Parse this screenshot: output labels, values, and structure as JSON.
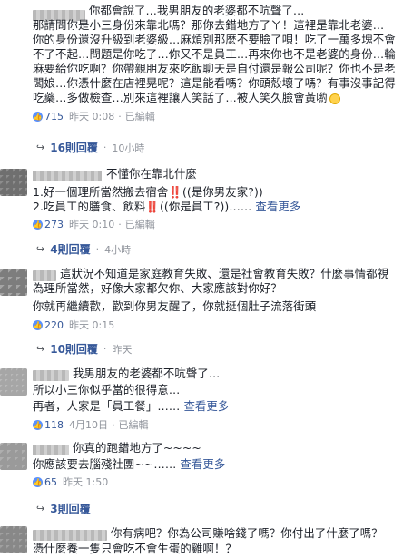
{
  "c1": {
    "lines": [
      "你都會說了…我男朋友的老婆都不吭聲了…",
      "那請問你是小三身份來靠北嗎？那你去錯地方了ㄚ！這裡是靠北老婆…",
      "你的身份還沒升級到老婆級…麻煩別那麼不要臉了唄！吃了一萬多塊不會",
      "不了不起…問題是你吃了…你又不是員工…再來你也不是老婆的身份…輪",
      "麻要給你吃啊？你帶親朋友來吃飯聊天是自付還是報公司呢？你也不是老",
      "闆娘…你憑什麼在店裡晃呢？這是能看嗎？你頭殼壞了嗎？有事沒事記得",
      "吃藥…多做檢查…別來這裡讓人笑話了…被人笑久臉會黃喲"
    ],
    "likes": "715",
    "time": "昨天 0:08",
    "edited": "已編輯",
    "replies": "16則回覆",
    "replies_time": "10小時"
  },
  "c2": {
    "name_suffix": "不懂你在靠北什麼",
    "lines": [
      "1.好一個理所當然搬去宿舍‼️((是你男友家?))",
      "2.吃員工的膳食、飲料‼️((你是員工?))……",
      "查看更多"
    ],
    "likes": "273",
    "time": "昨天 0:10",
    "edited": "已編輯",
    "replies": "4則回覆",
    "replies_time": "4小時"
  },
  "c3": {
    "lines": [
      "這狀況不知道是家庭教育失敗、還是社會教育失敗？什麼事情都視",
      "為理所當然，好像大家都欠你、大家應該對你好？",
      "你就再繼續歡，歡到你男友醒了，你就挺個肚子流落街頭"
    ],
    "likes": "220",
    "time": "昨天 0:15",
    "replies": "10則回覆",
    "replies_time": "昨天"
  },
  "c4": {
    "lines": [
      "我男朋友的老婆都不吭聲了…",
      "所以小三你似乎當的很得意…",
      "再者，人家是「員工餐」……",
      "查看更多"
    ],
    "likes": "118",
    "time": "4月10日",
    "edited": "已編輯"
  },
  "c5": {
    "lines": [
      "你真的跑錯地方了~~~~",
      "你應該要去腦殘社團~~……",
      "查看更多"
    ],
    "likes": "65",
    "time": "昨天 1:50",
    "replies": "3則回覆"
  },
  "c6": {
    "lines": [
      "你有病吧？你為公司賺啥錢了嗎？你付出了什麼了嗎？",
      "憑什麼養一隻只會吃不會生蛋的雞啊！？"
    ]
  }
}
